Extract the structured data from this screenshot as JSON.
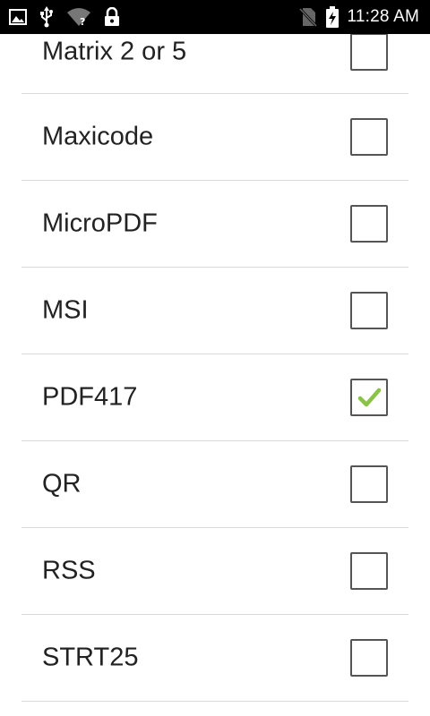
{
  "status_bar": {
    "time": "11:28 AM",
    "icons": [
      "image-icon",
      "usb-icon",
      "wifi-unknown-icon",
      "lock-icon",
      "no-sim-icon",
      "battery-charging-icon"
    ]
  },
  "list": {
    "items": [
      {
        "label": "Matrix 2 or 5",
        "checked": false
      },
      {
        "label": "Maxicode",
        "checked": false
      },
      {
        "label": "MicroPDF",
        "checked": false
      },
      {
        "label": "MSI",
        "checked": false
      },
      {
        "label": "PDF417",
        "checked": true
      },
      {
        "label": "QR",
        "checked": false
      },
      {
        "label": "RSS",
        "checked": false
      },
      {
        "label": "STRT25",
        "checked": false
      }
    ]
  },
  "colors": {
    "status_bar_bg": "#000000",
    "checkmark": "#8bc34a",
    "divider": "#d9d9d9"
  }
}
